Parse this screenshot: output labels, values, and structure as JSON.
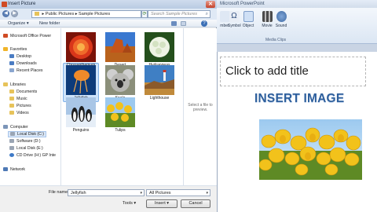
{
  "powerpoint": {
    "title": "Microsoft PowerPoint",
    "ribbon": {
      "buttons": [
        "mber",
        "Symbol",
        "Object",
        "Movie",
        "Sound"
      ],
      "group_label": "Media Clips"
    },
    "slide": {
      "title_placeholder": "Click to add title",
      "heading": "INSERT IMAGE"
    }
  },
  "dialog": {
    "title": "Insert Picture",
    "close": "✕",
    "nav": {
      "back": "◀",
      "forward": "▶",
      "refresh": "⟳"
    },
    "address": [
      "Public Pictures",
      "Sample Pictures"
    ],
    "address_sep": "▸",
    "search_placeholder": "Search Sample Pictures",
    "toolbar": {
      "organize": "Organize ▾",
      "new_folder": "New folder",
      "help": "?"
    },
    "sidebar": {
      "top": "Microsoft Office Power",
      "favorites": "Favorites",
      "favorites_items": [
        "Desktop",
        "Downloads",
        "Recent Places"
      ],
      "libraries": "Libraries",
      "libraries_items": [
        "Documents",
        "Music",
        "Pictures",
        "Videos"
      ],
      "computer": "Computer",
      "computer_items": [
        "Local Disk (C:)",
        "Software (D:)",
        "Local Disk (E:)",
        "CD Drive (H:) GP Inte"
      ],
      "network": "Network"
    },
    "files": [
      "Chrysanthemum",
      "Desert",
      "Hydrangeas",
      "Jellyfish",
      "Koala",
      "Lighthouse",
      "Penguins",
      "Tulips"
    ],
    "selected_file": "Jellyfish",
    "preview_text": "Select a file to preview.",
    "bottom": {
      "file_name_label": "File name:",
      "file_name_value": "Jellyfish",
      "filter_value": "All Pictures",
      "tools_label": "Tools",
      "insert_label": "Insert",
      "cancel_label": "Cancel"
    }
  },
  "colors": {
    "selection": "#cde3fb",
    "heading": "#2e5f9c",
    "titlebar": "#b9cbe3"
  }
}
